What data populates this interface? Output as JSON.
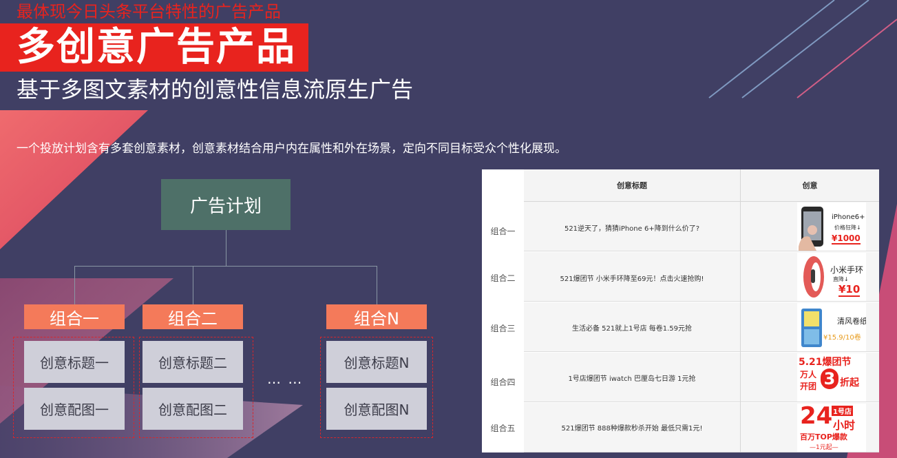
{
  "header": {
    "kicker": "最体现今日头条平台特性的广告产品",
    "title": "多创意广告产品",
    "subtitle": "基于多图文素材的创意性信息流原生广告"
  },
  "description": "一个投放计划含有多套创意素材，创意素材结合用户内在属性和外在场景，定向不同目标受众个性化展现。",
  "diagram": {
    "plan": "广告计划",
    "groups": [
      {
        "name": "组合一",
        "title": "创意标题一",
        "image": "创意配图一"
      },
      {
        "name": "组合二",
        "title": "创意标题二",
        "image": "创意配图二"
      },
      {
        "name": "组合N",
        "title": "创意标题N",
        "image": "创意配图N"
      }
    ],
    "ellipsis": "… …"
  },
  "table": {
    "headers": [
      "创意标题",
      "创意"
    ],
    "rows": [
      {
        "label": "组合一",
        "title": "521逆天了，猜猜iPhone 6+降到什么价了?"
      },
      {
        "label": "组合二",
        "title": "521爆团节 小米手环降至69元！点击火速抢购!"
      },
      {
        "label": "组合三",
        "title": "生活必备 521就上1号店 每卷1.59元抢"
      },
      {
        "label": "组合四",
        "title": "1号店爆团节 iwatch 巴厘岛七日游 1元抢"
      },
      {
        "label": "组合五",
        "title": "521爆团节 888种爆款秒杀开始 最低只需1元!"
      }
    ],
    "creatives": [
      {
        "icon": "iphone-icon",
        "lines": [
          "iPhone6+",
          "价格狂降↓",
          "¥1000"
        ]
      },
      {
        "icon": "wristband-icon",
        "lines": [
          "小米手环",
          "直降↓",
          "¥10"
        ]
      },
      {
        "icon": "tissue-pack-icon",
        "lines": [
          "清风卷纸",
          "¥15.9/10卷"
        ]
      },
      {
        "lines": [
          "5.21爆团节",
          "万人",
          "开团",
          "3",
          "折起"
        ]
      },
      {
        "lines": [
          "24",
          "1号店",
          "小时",
          "百万TOP爆款",
          "—1元起—"
        ]
      }
    ]
  },
  "colors": {
    "background": "#403f64",
    "accent_red": "#e8231e",
    "plan_box": "#4e7068",
    "group_head": "#f47a5a",
    "cell": "#cfcfd9"
  }
}
